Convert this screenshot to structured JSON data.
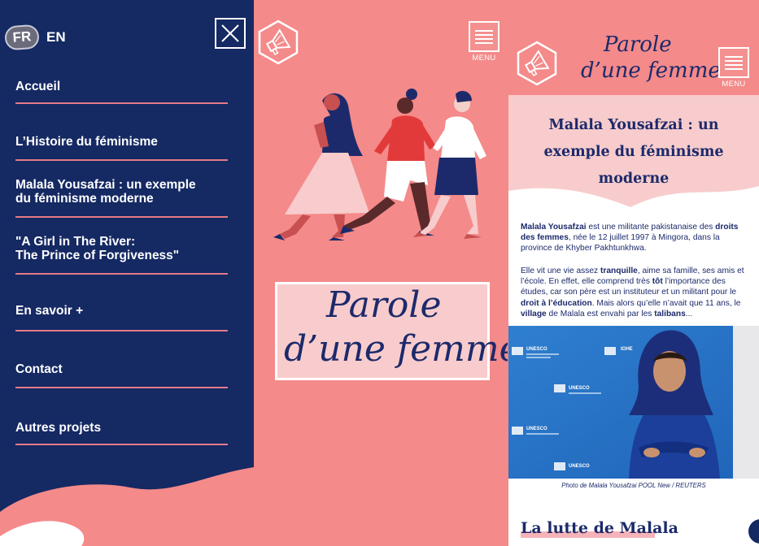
{
  "menu_panel": {
    "lang_fr": "FR",
    "lang_en": "EN",
    "items": [
      {
        "label": "Accueil"
      },
      {
        "label": "L’Histoire du féminisme"
      },
      {
        "label": "Malala Yousafzai : un exemple\ndu féminisme moderne"
      },
      {
        "label": "\"A Girl in The River:\nThe Prince of Forgiveness\""
      },
      {
        "label": "En savoir +"
      },
      {
        "label": "Contact"
      },
      {
        "label": "Autres projets"
      }
    ]
  },
  "home_panel": {
    "menu_label": "MENU",
    "title_line1": "Parole",
    "title_line2": "d’une femme"
  },
  "article_panel": {
    "header_line1": "Parole",
    "header_line2": "d’une femme",
    "menu_label": "MENU",
    "title": "Malala Yousafzai : un exemple du féminisme moderne",
    "paragraph1": {
      "b1": "Malala Yousafzai",
      "t1": " est une militante pakistanaise des ",
      "b2": "droits des femmes",
      "t2": ", née le 12 juillet 1997 à Mingora, dans la province de Khyber Pakhtunkhwa."
    },
    "paragraph2": {
      "t1": "Elle vit une vie assez ",
      "b1": "tranquille",
      "t2": ", aime sa famille, ses amis et l’école. En effet, elle comprend très ",
      "b2": "tôt",
      "t3": " l’importance des études, car son père est un instituteur et un militant pour le ",
      "b3": "droit à l’éducation",
      "t4": ". Mais alors qu’elle n’avait que 11 ans, le ",
      "b4": "village",
      "t5": " de Malala est envahi par les ",
      "b5": "talibans",
      "t6": "..."
    },
    "photo_texts": [
      "UNESCO",
      "UNESCO",
      "UNESCO",
      "UNESCO",
      "IOHE"
    ],
    "caption": "Photo de Malala Yousafzai POOL New / REUTERS",
    "section_title": "La lutte de Malala"
  },
  "colors": {
    "navy": "#152963",
    "coral": "#f48a8a",
    "pink": "#f8cccc",
    "divider": "#e57b86"
  }
}
